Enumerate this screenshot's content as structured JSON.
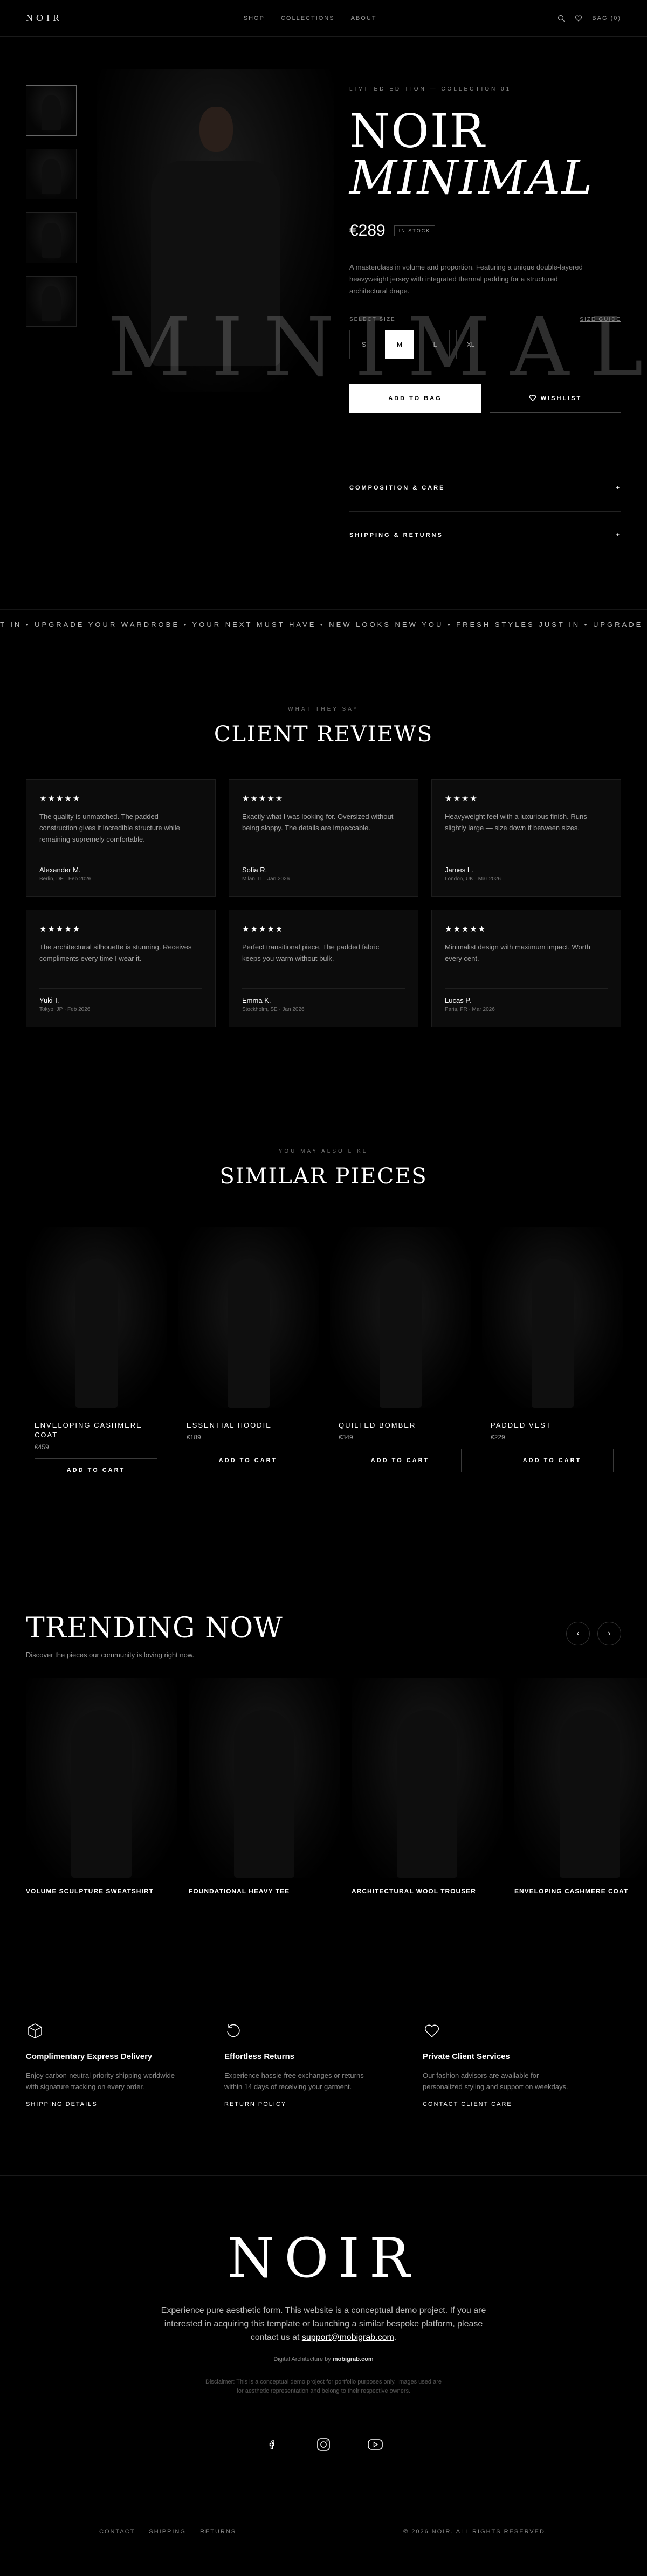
{
  "nav": {
    "logo": "NOIR",
    "links": [
      "SHOP",
      "COLLECTIONS",
      "ABOUT"
    ],
    "bag": "BAG (0)"
  },
  "product": {
    "edition": "LIMITED EDITION — COLLECTION 01",
    "title_line1": "NOIR",
    "title_line2": "MINIMAL",
    "price": "€289",
    "stock": "IN STOCK",
    "description": "A masterclass in volume and proportion. Featuring a unique double-layered heavyweight jersey with integrated thermal padding for a structured architectural drape.",
    "background_word": "MINIMAL",
    "size_label": "SELECT SIZE",
    "size_guide": "SIZE GUIDE",
    "sizes": [
      "S",
      "M",
      "L",
      "XL"
    ],
    "selected_size": "M",
    "add_to_bag": "ADD TO BAG",
    "wishlist": "WISHLIST",
    "accordion": [
      "COMPOSITION & CARE",
      "SHIPPING & RETURNS"
    ],
    "accordion_icon": "+"
  },
  "marquee": "T IN  •  UPGRADE YOUR WARDROBE  •  YOUR NEXT MUST HAVE  •    NEW LOOKS NEW YOU  •  FRESH STYLES JUST IN  •  UPGRADE YOUR WARDROBE  •  YOUR NEXT MUST HAVE  •  NEW LOOKS NEW YOU  •",
  "reviews": {
    "eyebrow": "WHAT THEY SAY",
    "title": "CLIENT REVIEWS",
    "items": [
      {
        "stars": "★★★★★",
        "text": "The quality is unmatched. The padded construction gives it incredible structure while remaining supremely comfortable.",
        "name": "Alexander M.",
        "meta": "Berlin, DE · Feb 2026"
      },
      {
        "stars": "★★★★★",
        "text": "Exactly what I was looking for. Oversized without being sloppy. The details are impeccable.",
        "name": "Sofia R.",
        "meta": "Milan, IT · Jan 2026"
      },
      {
        "stars": "★★★★",
        "text": "Heavyweight feel with a luxurious finish. Runs slightly large — size down if between sizes.",
        "name": "James L.",
        "meta": "London, UK · Mar 2026"
      },
      {
        "stars": "★★★★★",
        "text": "The architectural silhouette is stunning. Receives compliments every time I wear it.",
        "name": "Yuki T.",
        "meta": "Tokyo, JP · Feb 2026"
      },
      {
        "stars": "★★★★★",
        "text": "Perfect transitional piece. The padded fabric keeps you warm without bulk.",
        "name": "Emma K.",
        "meta": "Stockholm, SE · Jan 2026"
      },
      {
        "stars": "★★★★★",
        "text": "Minimalist design with maximum impact. Worth every cent.",
        "name": "Lucas P.",
        "meta": "Paris, FR · Mar 2026"
      }
    ]
  },
  "similar": {
    "eyebrow": "YOU MAY ALSO LIKE",
    "title": "SIMILAR PIECES",
    "button": "ADD TO CART",
    "items": [
      {
        "name": "ENVELOPING CASHMERE COAT",
        "price": "€459"
      },
      {
        "name": "ESSENTIAL HOODIE",
        "price": "€189"
      },
      {
        "name": "QUILTED BOMBER",
        "price": "€349"
      },
      {
        "name": "PADDED VEST",
        "price": "€229"
      }
    ]
  },
  "trending": {
    "title": "TRENDING NOW",
    "subtitle": "Discover the pieces our community is loving right now.",
    "prev": "‹",
    "next": "›",
    "items": [
      "VOLUME SCULPTURE SWEATSHIRT",
      "FOUNDATIONAL HEAVY TEE",
      "ARCHITECTURAL WOOL TROUSER",
      "ENVELOPING CASHMERE COAT"
    ]
  },
  "features": [
    {
      "icon": "box-icon",
      "title": "Complimentary Express Delivery",
      "text": "Enjoy carbon-neutral priority shipping worldwide with signature tracking on every order.",
      "link": "SHIPPING DETAILS"
    },
    {
      "icon": "return-icon",
      "title": "Effortless Returns",
      "text": "Experience hassle-free exchanges or returns within 14 days of receiving your garment.",
      "link": "RETURN POLICY"
    },
    {
      "icon": "heart-icon",
      "title": "Private Client Services",
      "text": "Our fashion advisors are available for personalized styling and support on weekdays.",
      "link": "CONTACT CLIENT CARE"
    }
  ],
  "footer": {
    "logo": "NOIR",
    "text_before": "Experience pure aesthetic form. This website is a conceptual demo project. If you are interested in acquiring this template or launching a similar bespoke platform, please contact us at ",
    "email": "support@mobigrab.com",
    "text_after": ".",
    "credit_prefix": "Digital Architecture by ",
    "credit_name": "mobigrab.com",
    "disclaimer": "Disclaimer: This is a conceptual demo project for portfolio purposes only. Images used are for aesthetic representation and belong to their respective owners.",
    "social_icons": [
      "facebook-icon",
      "instagram-icon",
      "youtube-icon"
    ],
    "links": [
      "CONTACT",
      "SHIPPING",
      "RETURNS"
    ],
    "copyright": "© 2026 NOIR. ALL RIGHTS RESERVED."
  }
}
